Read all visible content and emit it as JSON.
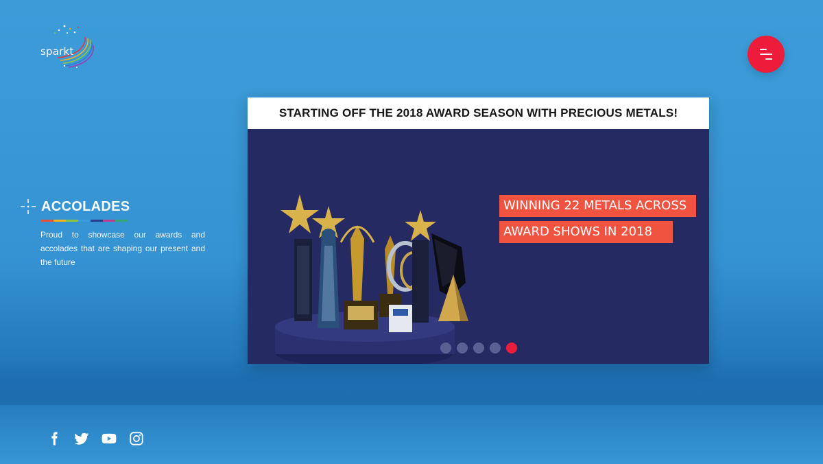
{
  "brand": {
    "name": "sparkt",
    "logo_colors": [
      "#e83a3a",
      "#f5b21b",
      "#8cc63e",
      "#2f7bd9",
      "#9b3fb5"
    ]
  },
  "menu": {
    "icon": "hamburger-menu-icon",
    "color": "#ec1c3a"
  },
  "section": {
    "icon": "sparkle-crosshair-icon",
    "title": "ACCOLADES",
    "rule_colors": [
      "#e8503a",
      "#f5b21b",
      "#8cc63e",
      "#3a9be0",
      "#2d3a8c",
      "#c23b8a",
      "#3aa66b"
    ],
    "description": "Proud to showcase our awards and accolades that are shaping our present and the future"
  },
  "slide": {
    "heading": "STARTING OFF THE 2018 AWARD SEASON WITH PRECIOUS METALS!",
    "banner_line_1": "WINNING 22 METALS ACROSS",
    "banner_line_2": "AWARD SHOWS IN 2018",
    "image_alt": "trophies-on-podium",
    "background": "#252a63",
    "accent": "#f0533f"
  },
  "carousel": {
    "total_slides": 5,
    "active_index": 5
  },
  "social": [
    {
      "name": "facebook-icon"
    },
    {
      "name": "twitter-icon"
    },
    {
      "name": "youtube-icon"
    },
    {
      "name": "instagram-icon"
    }
  ]
}
